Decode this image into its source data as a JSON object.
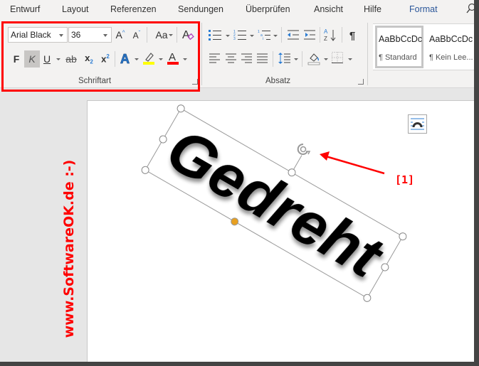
{
  "menu": {
    "tabs": [
      {
        "label": "Entwurf"
      },
      {
        "label": "Layout"
      },
      {
        "label": "Referenzen"
      },
      {
        "label": "Sendungen"
      },
      {
        "label": "Überprüfen"
      },
      {
        "label": "Ansicht"
      },
      {
        "label": "Hilfe"
      },
      {
        "label": "Format",
        "active": true
      }
    ],
    "search_icon": "search-icon"
  },
  "ribbon": {
    "font_group": {
      "label": "Schriftart",
      "font_name": "Arial Black",
      "font_size": "36",
      "grow_font": "A^",
      "shrink_font": "Aˇ",
      "change_case": "Aa",
      "bold": "F",
      "italic": "K",
      "underline": "U",
      "strikethrough": "ab",
      "subscript": "x₂",
      "superscript": "x²",
      "text_effects": "A",
      "font_color": "A",
      "highlight_color": "#ffff00",
      "font_color_value": "#ff0000",
      "italic_active": true
    },
    "paragraph_group": {
      "label": "Absatz"
    },
    "styles": [
      {
        "sample": "AaBbCcDc",
        "name": "¶ Standard",
        "selected": true
      },
      {
        "sample": "AaBbCcDc",
        "name": "¶ Kein Lee..."
      }
    ]
  },
  "document": {
    "wordart_text": "Gedreht",
    "rotation_degrees": 30,
    "watermark": "www.SoftwareOK.de :-)",
    "annotation": "[1]"
  },
  "colors": {
    "accent": "#2b579a",
    "highlight_red": "#ff0000",
    "handle_orange": "#e8a020"
  }
}
